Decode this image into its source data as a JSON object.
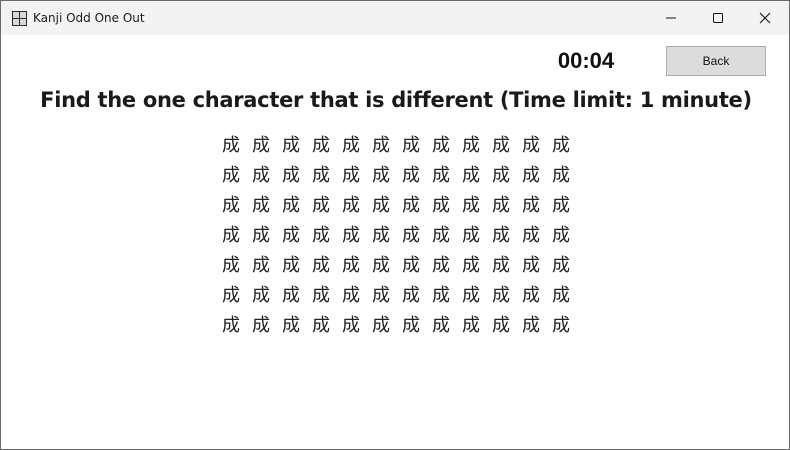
{
  "window": {
    "title": "Kanji Odd One Out",
    "controls": {
      "minimize_icon": "minimize-icon",
      "maximize_icon": "maximize-icon",
      "close_icon": "close-icon"
    }
  },
  "game": {
    "timer": "00:04",
    "back_label": "Back",
    "instruction": "Find the one character that is different (Time limit: 1 minute)",
    "grid": [
      [
        "成",
        "成",
        "成",
        "成",
        "成",
        "成",
        "成",
        "成",
        "成",
        "成",
        "成",
        "成"
      ],
      [
        "成",
        "成",
        "成",
        "成",
        "成",
        "成",
        "成",
        "成",
        "成",
        "成",
        "成",
        "成"
      ],
      [
        "成",
        "成",
        "成",
        "成",
        "成",
        "成",
        "成",
        "成",
        "成",
        "成",
        "成",
        "成"
      ],
      [
        "成",
        "成",
        "成",
        "成",
        "成",
        "成",
        "成",
        "成",
        "成",
        "成",
        "成",
        "成"
      ],
      [
        "成",
        "成",
        "成",
        "成",
        "成",
        "成",
        "成",
        "成",
        "成",
        "成",
        "成",
        "成"
      ],
      [
        "成",
        "成",
        "成",
        "成",
        "成",
        "成",
        "成",
        "成",
        "成",
        "成",
        "成",
        "成"
      ],
      [
        "成",
        "成",
        "成",
        "成",
        "成",
        "成",
        "成",
        "成",
        "成",
        "成",
        "成",
        "成"
      ]
    ]
  }
}
